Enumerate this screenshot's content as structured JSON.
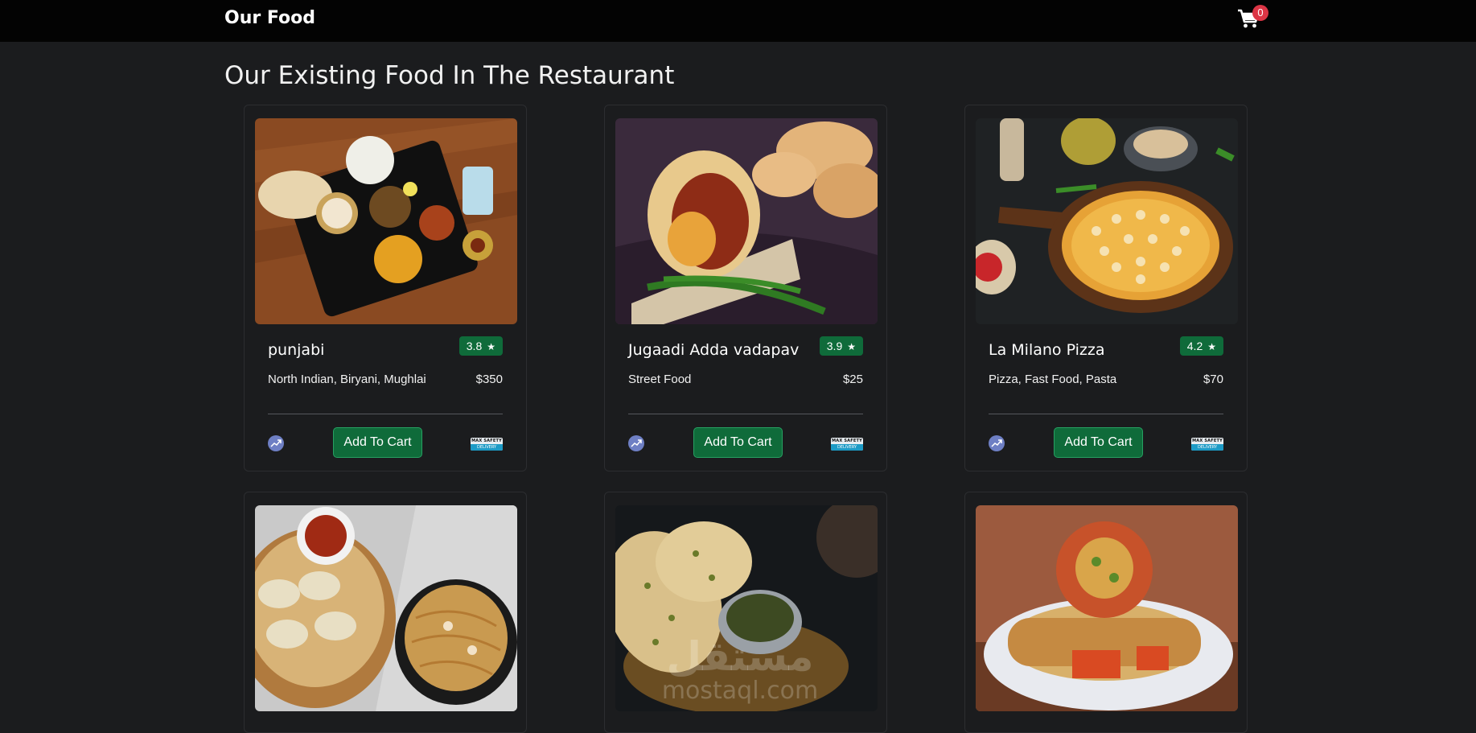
{
  "navbar": {
    "brand": "Our Food",
    "cart_icon": "shopping-cart-icon",
    "cart_count": "0"
  },
  "page": {
    "title": "Our Existing Food In The Restaurant"
  },
  "cards": [
    {
      "name": "punjabi",
      "rating": "3.8",
      "cuisine": "North Indian, Biryani, Mughlai",
      "price": "$350",
      "button": "Add To Cart",
      "image": "punjabi-thali-photo"
    },
    {
      "name": "Jugaadi Adda vadapav",
      "rating": "3.9",
      "cuisine": "Street Food",
      "price": "$25",
      "button": "Add To Cart",
      "image": "vada-pav-photo"
    },
    {
      "name": "La Milano Pizza",
      "rating": "4.2",
      "cuisine": "Pizza, Fast Food, Pasta",
      "price": "$70",
      "button": "Add To Cart",
      "image": "pizza-photo"
    },
    {
      "image": "momos-noodles-photo"
    },
    {
      "image": "naan-curry-photo"
    },
    {
      "image": "kathi-roll-photo"
    }
  ],
  "safety_badge": {
    "top": "MAX SAFETY",
    "bottom": "DELIVERY"
  },
  "watermark": {
    "line1": "مستقل",
    "line2": "mostaql.com"
  },
  "colors": {
    "navbar_bg": "#030303",
    "page_bg": "#1b1c1e",
    "rating_bg": "#0f6b3a",
    "button_bg": "#0f6b3a",
    "badge_red": "#dc3545",
    "trend_icon": "#6e7fc4"
  }
}
